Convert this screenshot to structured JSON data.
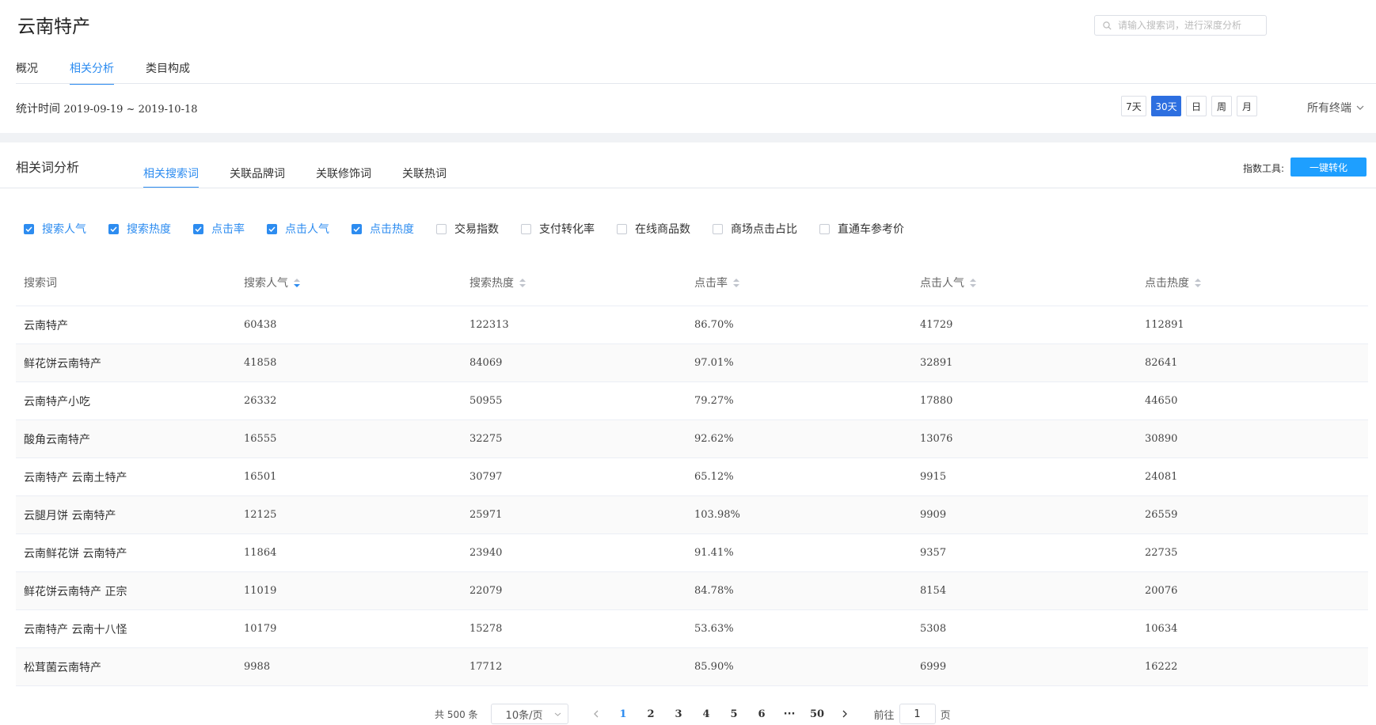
{
  "header": {
    "title": "云南特产",
    "search_placeholder": "请输入搜索词，进行深度分析",
    "tabs": [
      {
        "label": "概况",
        "active": false
      },
      {
        "label": "相关分析",
        "active": true
      },
      {
        "label": "类目构成",
        "active": false
      }
    ],
    "stat_label": "统计时间",
    "stat_range": "2019-09-19 ~ 2019-10-18",
    "ranges": [
      {
        "label": "7天",
        "active": false
      },
      {
        "label": "30天",
        "active": true
      },
      {
        "label": "日",
        "active": false
      },
      {
        "label": "周",
        "active": false
      },
      {
        "label": "月",
        "active": false
      }
    ],
    "terminal": "所有终端"
  },
  "section": {
    "title": "相关词分析",
    "tabs": [
      {
        "label": "相关搜索词",
        "active": true
      },
      {
        "label": "关联品牌词",
        "active": false
      },
      {
        "label": "关联修饰词",
        "active": false
      },
      {
        "label": "关联热词",
        "active": false
      }
    ],
    "index_tool_label": "指数工具:",
    "convert_button": "一键转化"
  },
  "metrics": [
    {
      "label": "搜索人气",
      "checked": true
    },
    {
      "label": "搜索热度",
      "checked": true
    },
    {
      "label": "点击率",
      "checked": true
    },
    {
      "label": "点击人气",
      "checked": true
    },
    {
      "label": "点击热度",
      "checked": true
    },
    {
      "label": "交易指数",
      "checked": false
    },
    {
      "label": "支付转化率",
      "checked": false
    },
    {
      "label": "在线商品数",
      "checked": false
    },
    {
      "label": "商场点击占比",
      "checked": false
    },
    {
      "label": "直通车参考价",
      "checked": false
    }
  ],
  "table": {
    "columns": [
      "搜索词",
      "搜索人气",
      "搜索热度",
      "点击率",
      "点击人气",
      "点击热度"
    ],
    "sorted_column": 1,
    "rows": [
      [
        "云南特产",
        "60438",
        "122313",
        "86.70%",
        "41729",
        "112891"
      ],
      [
        "鲜花饼云南特产",
        "41858",
        "84069",
        "97.01%",
        "32891",
        "82641"
      ],
      [
        "云南特产小吃",
        "26332",
        "50955",
        "79.27%",
        "17880",
        "44650"
      ],
      [
        "酸角云南特产",
        "16555",
        "32275",
        "92.62%",
        "13076",
        "30890"
      ],
      [
        "云南特产 云南土特产",
        "16501",
        "30797",
        "65.12%",
        "9915",
        "24081"
      ],
      [
        "云腿月饼 云南特产",
        "12125",
        "25971",
        "103.98%",
        "9909",
        "26559"
      ],
      [
        "云南鲜花饼 云南特产",
        "11864",
        "23940",
        "91.41%",
        "9357",
        "22735"
      ],
      [
        "鲜花饼云南特产 正宗",
        "11019",
        "22079",
        "84.78%",
        "8154",
        "20076"
      ],
      [
        "云南特产 云南十八怪",
        "10179",
        "15278",
        "53.63%",
        "5308",
        "10634"
      ],
      [
        "松茸菌云南特产",
        "9988",
        "17712",
        "85.90%",
        "6999",
        "16222"
      ]
    ]
  },
  "pagination": {
    "total": "共 500 条",
    "page_size": "10条/页",
    "pages": [
      "1",
      "2",
      "3",
      "4",
      "5",
      "6"
    ],
    "ellipsis": "···",
    "last_page": "50",
    "current_page": "1",
    "goto_label": "前往",
    "goto_value": "1",
    "goto_suffix": "页"
  },
  "colors": {
    "accent": "#2d8cf0",
    "active_range_bg": "#2d6fe0",
    "convert_bg": "#1e9fff"
  }
}
